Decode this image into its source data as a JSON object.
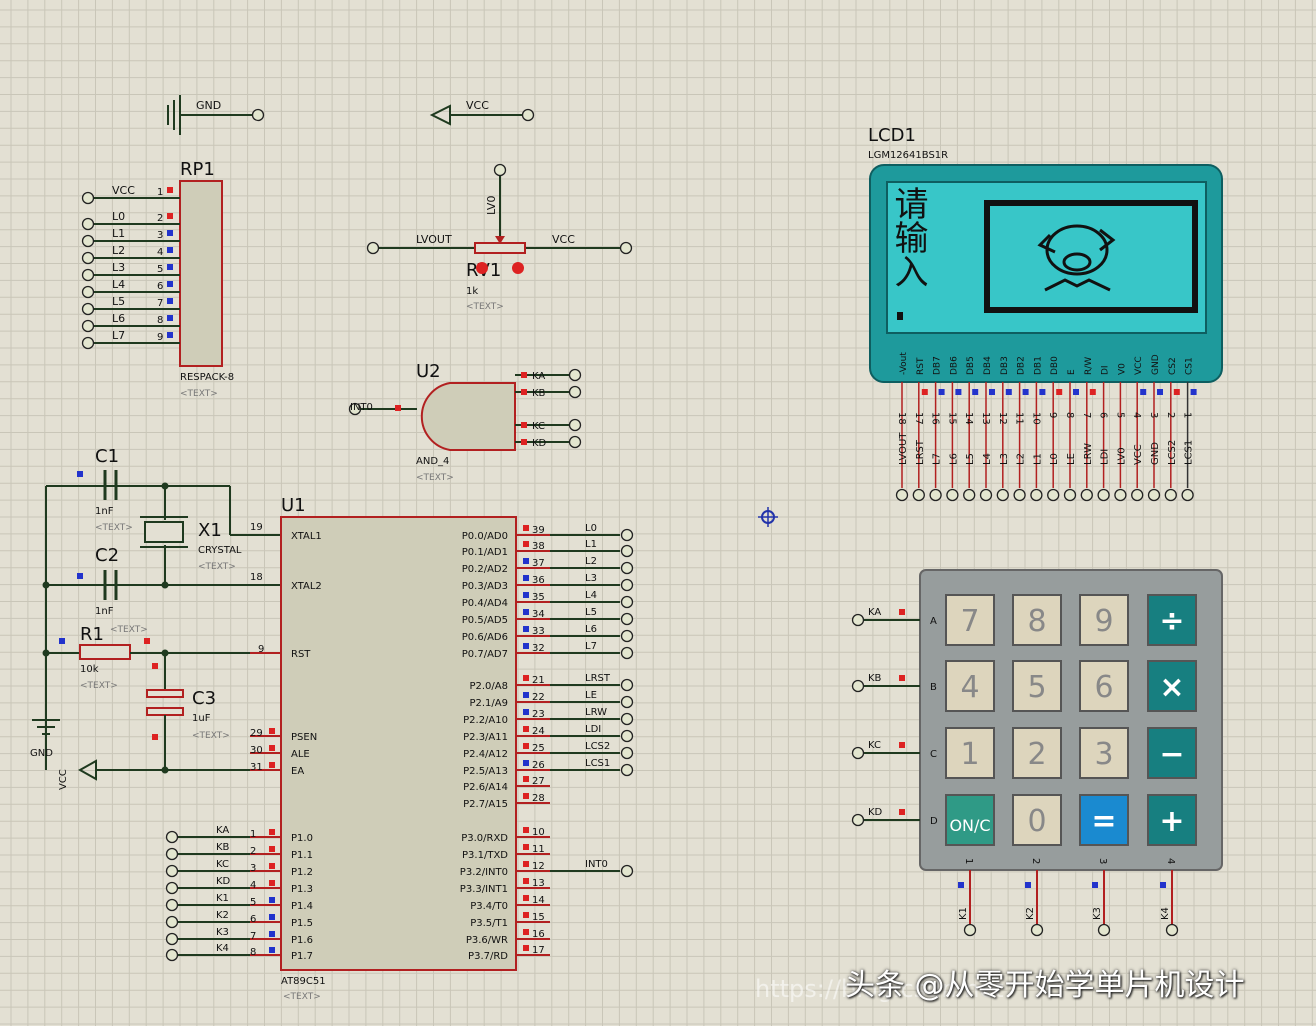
{
  "colors": {
    "background": "#e3e0d3",
    "grid": "#c9c6b8",
    "wire": "#1f3a1f",
    "pin": "#b22020",
    "body": "#cfcdb8",
    "lcd_body": "#1e9a9c",
    "lcd_screen": "#38c6c8",
    "key_num": "#ddd5bd",
    "key_op": "#177f80",
    "key_eq": "#1a8ad0",
    "key_on": "#2f9a86",
    "keypad_body": "#979d9d"
  },
  "power": {
    "gnd": "GND",
    "vcc": "VCC"
  },
  "rp1": {
    "ref": "RP1",
    "value": "RESPACK-8",
    "text": "<TEXT>",
    "nets": [
      "VCC",
      "L0",
      "L1",
      "L2",
      "L3",
      "L4",
      "L5",
      "L6",
      "L7"
    ],
    "pins": [
      "1",
      "2",
      "3",
      "4",
      "5",
      "6",
      "7",
      "8",
      "9"
    ]
  },
  "pot": {
    "ref": "RV1",
    "value": "1k",
    "text": "<TEXT>",
    "left": "LVOUT",
    "right": "VCC",
    "top": "LV0"
  },
  "u2": {
    "ref": "U2",
    "value": "AND_4",
    "text": "<TEXT>",
    "inputs": [
      "KA",
      "KB",
      "KC",
      "KD"
    ],
    "output": "INT0"
  },
  "osc": {
    "c1": "C1",
    "c1v": "1nF",
    "c2": "C2",
    "c2v": "1nF",
    "x1": "X1",
    "x1v": "CRYSTAL",
    "r1": "R1",
    "r1v": "10k",
    "c3": "C3",
    "c3v": "1uF",
    "text": "<TEXT>",
    "gnd": "GND",
    "vcc": "VCC"
  },
  "u1": {
    "ref": "U1",
    "value": "AT89C51",
    "text": "<TEXT>",
    "left": [
      {
        "n": "19",
        "name": "XTAL1"
      },
      {
        "n": "18",
        "name": "XTAL2"
      },
      {
        "n": "9",
        "name": "RST"
      },
      {
        "n": "29",
        "name": "PSEN"
      },
      {
        "n": "30",
        "name": "ALE"
      },
      {
        "n": "31",
        "name": "EA"
      },
      {
        "n": "1",
        "name": "P1.0",
        "net": "KA"
      },
      {
        "n": "2",
        "name": "P1.1",
        "net": "KB"
      },
      {
        "n": "3",
        "name": "P1.2",
        "net": "KC"
      },
      {
        "n": "4",
        "name": "P1.3",
        "net": "KD"
      },
      {
        "n": "5",
        "name": "P1.4",
        "net": "K1"
      },
      {
        "n": "6",
        "name": "P1.5",
        "net": "K2"
      },
      {
        "n": "7",
        "name": "P1.6",
        "net": "K3"
      },
      {
        "n": "8",
        "name": "P1.7",
        "net": "K4"
      }
    ],
    "right": [
      {
        "n": "39",
        "name": "P0.0/AD0",
        "net": "L0"
      },
      {
        "n": "38",
        "name": "P0.1/AD1",
        "net": "L1"
      },
      {
        "n": "37",
        "name": "P0.2/AD2",
        "net": "L2"
      },
      {
        "n": "36",
        "name": "P0.3/AD3",
        "net": "L3"
      },
      {
        "n": "35",
        "name": "P0.4/AD4",
        "net": "L4"
      },
      {
        "n": "34",
        "name": "P0.5/AD5",
        "net": "L5"
      },
      {
        "n": "33",
        "name": "P0.6/AD6",
        "net": "L6"
      },
      {
        "n": "32",
        "name": "P0.7/AD7",
        "net": "L7"
      },
      {
        "n": "21",
        "name": "P2.0/A8",
        "net": "LRST"
      },
      {
        "n": "22",
        "name": "P2.1/A9",
        "net": "LE"
      },
      {
        "n": "23",
        "name": "P2.2/A10",
        "net": "LRW"
      },
      {
        "n": "24",
        "name": "P2.3/A11",
        "net": "LDI"
      },
      {
        "n": "25",
        "name": "P2.4/A12",
        "net": "LCS2"
      },
      {
        "n": "26",
        "name": "P2.5/A13",
        "net": "LCS1"
      },
      {
        "n": "27",
        "name": "P2.6/A14"
      },
      {
        "n": "28",
        "name": "P2.7/A15"
      },
      {
        "n": "10",
        "name": "P3.0/RXD"
      },
      {
        "n": "11",
        "name": "P3.1/TXD"
      },
      {
        "n": "12",
        "name": "P3.2/INT0",
        "net": "INT0"
      },
      {
        "n": "13",
        "name": "P3.3/INT1"
      },
      {
        "n": "14",
        "name": "P3.4/T0"
      },
      {
        "n": "15",
        "name": "P3.5/T1"
      },
      {
        "n": "16",
        "name": "P3.6/WR"
      },
      {
        "n": "17",
        "name": "P3.7/RD"
      }
    ]
  },
  "lcd": {
    "ref": "LCD1",
    "value": "LGM12641BS1R",
    "screen_text": "请输入",
    "pins": [
      {
        "n": "18",
        "name": "-Vout",
        "net": "LVOUT"
      },
      {
        "n": "17",
        "name": "RST",
        "net": "LRST"
      },
      {
        "n": "16",
        "name": "DB7",
        "net": "L7"
      },
      {
        "n": "15",
        "name": "DB6",
        "net": "L6"
      },
      {
        "n": "14",
        "name": "DB5",
        "net": "L5"
      },
      {
        "n": "13",
        "name": "DB4",
        "net": "L4"
      },
      {
        "n": "12",
        "name": "DB3",
        "net": "L3"
      },
      {
        "n": "11",
        "name": "DB2",
        "net": "L2"
      },
      {
        "n": "10",
        "name": "DB1",
        "net": "L1"
      },
      {
        "n": "9",
        "name": "DB0",
        "net": "L0"
      },
      {
        "n": "8",
        "name": "E",
        "net": "LE"
      },
      {
        "n": "7",
        "name": "R/W",
        "net": "LRW"
      },
      {
        "n": "6",
        "name": "DI",
        "net": "LDI"
      },
      {
        "n": "5",
        "name": "V0",
        "net": "LV0"
      },
      {
        "n": "4",
        "name": "VCC",
        "net": "VCC"
      },
      {
        "n": "3",
        "name": "GND",
        "net": "GND"
      },
      {
        "n": "2",
        "name": "CS2",
        "net": "LCS2"
      },
      {
        "n": "1",
        "name": "CS1",
        "net": "LCS1"
      }
    ]
  },
  "keypad": {
    "rows": [
      "A",
      "B",
      "C",
      "D"
    ],
    "row_nets": [
      "KA",
      "KB",
      "KC",
      "KD"
    ],
    "cols": [
      "1",
      "2",
      "3",
      "4"
    ],
    "col_nets": [
      "K1",
      "K2",
      "K3",
      "K4"
    ],
    "keys": [
      [
        "7",
        "8",
        "9",
        "÷"
      ],
      [
        "4",
        "5",
        "6",
        "×"
      ],
      [
        "1",
        "2",
        "3",
        "−"
      ],
      [
        "ON/C",
        "0",
        "=",
        "+"
      ]
    ]
  },
  "watermark": "头条 @从零开始学单片机设计",
  "watermark_faint": "https://blog.csdn.net"
}
